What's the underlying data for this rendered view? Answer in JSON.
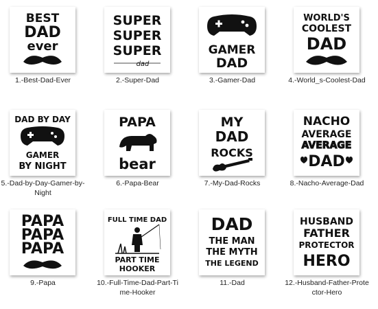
{
  "items": [
    {
      "caption": "1.-Best-Dad-Ever",
      "art": [
        "BEST",
        "DAD",
        "ever"
      ]
    },
    {
      "caption": "2.-Super-Dad",
      "art": [
        "SUPER",
        "SUPER",
        "SUPER",
        "dad"
      ]
    },
    {
      "caption": "3.-Gamer-Dad",
      "art": [
        "GAMER",
        "DAD"
      ]
    },
    {
      "caption": "4.-World_s-Coolest-Dad",
      "art": [
        "WORLD'S",
        "COOLEST",
        "DAD"
      ]
    },
    {
      "caption": "5.-Dad-by-Day-Gamer-by-Night",
      "art": [
        "DAD BY DAY",
        "GAMER",
        "BY NIGHT"
      ]
    },
    {
      "caption": "6.-Papa-Bear",
      "art": [
        "PAPA",
        "bear"
      ]
    },
    {
      "caption": "7.-My-Dad-Rocks",
      "art": [
        "MY",
        "DAD",
        "ROCKS"
      ]
    },
    {
      "caption": "8.-Nacho-Average-Dad",
      "art": [
        "NACHO",
        "AVERAGE",
        "AVERAGE",
        "DAD"
      ]
    },
    {
      "caption": "9.-Papa",
      "art": [
        "PAPA",
        "PAPA",
        "PAPA"
      ]
    },
    {
      "caption": "10.-Full-Time-Dad-Part-Time-Hooker",
      "art": [
        "FULL TIME DAD",
        "PART TIME",
        "HOOKER"
      ]
    },
    {
      "caption": "11.-Dad",
      "art": [
        "DAD",
        "THE MAN",
        "THE MYTH",
        "THE LEGEND"
      ]
    },
    {
      "caption": "12.-Husband-Father-Protector-Hero",
      "art": [
        "HUSBAND",
        "FATHER",
        "PROTECTOR",
        "HERO"
      ]
    }
  ]
}
